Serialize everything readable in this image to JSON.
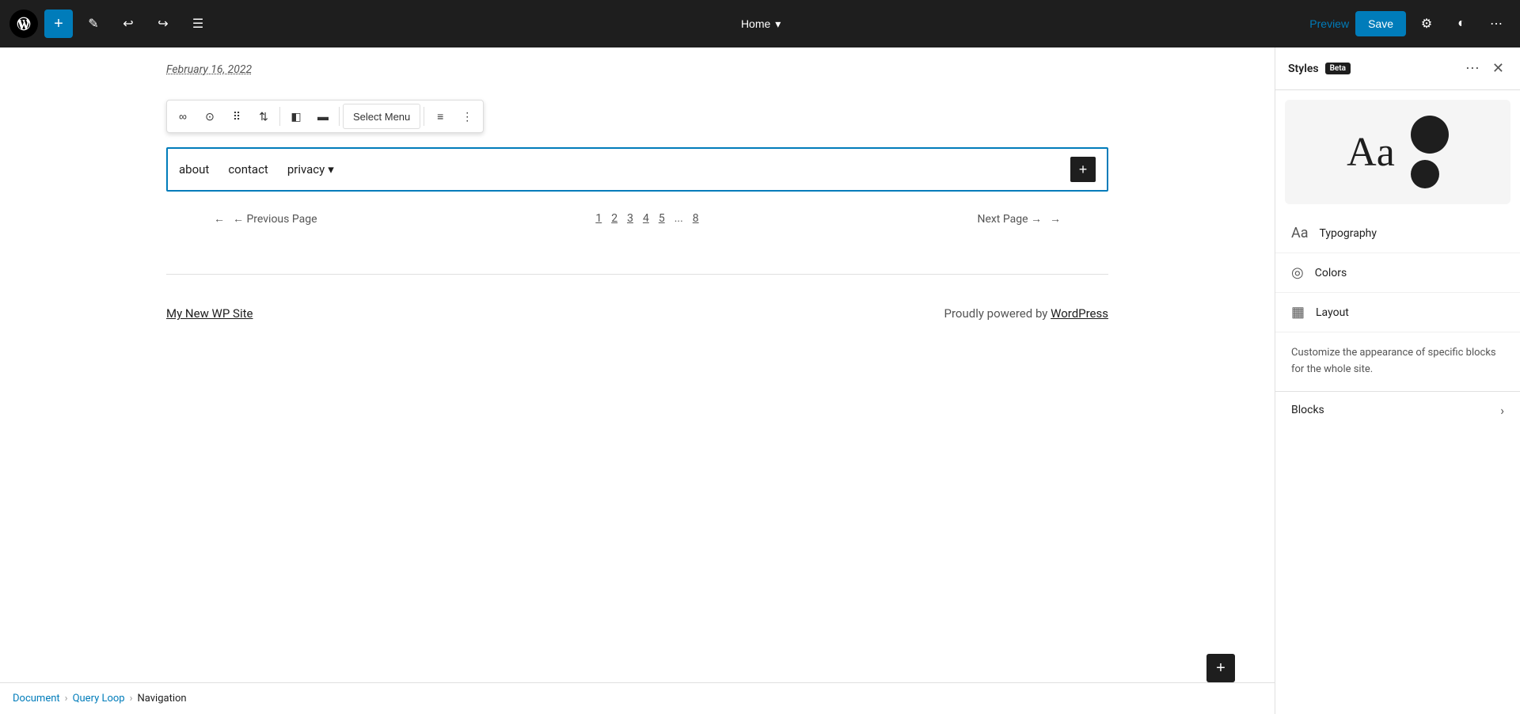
{
  "toolbar": {
    "add_label": "+",
    "preview_label": "Preview",
    "save_label": "Save",
    "page_title": "Home",
    "undo_icon": "↩",
    "redo_icon": "↪",
    "list_view_icon": "☰",
    "edit_icon": "✎",
    "settings_icon": "⚙",
    "contrast_icon": "◐",
    "more_icon": "⋯"
  },
  "canvas": {
    "date": "February 16, 2022",
    "nav": {
      "items": [
        {
          "label": "about",
          "has_dropdown": false
        },
        {
          "label": "contact",
          "has_dropdown": false
        },
        {
          "label": "privacy",
          "has_dropdown": true
        }
      ]
    },
    "pagination": {
      "prev_label": "← Previous Page",
      "next_label": "Next Page →",
      "pages": [
        "1",
        "2",
        "3",
        "4",
        "5",
        "...",
        "8"
      ]
    },
    "footer": {
      "site_link": "My New WP Site",
      "credit_text": "Proudly powered by ",
      "credit_link": "WordPress"
    }
  },
  "right_panel": {
    "header": {
      "title": "Styles",
      "beta_label": "Beta",
      "more_icon": "⋯",
      "close_icon": "✕"
    },
    "preview": {
      "text": "Aa"
    },
    "items": [
      {
        "id": "typography",
        "icon": "Aa",
        "label": "Typography"
      },
      {
        "id": "colors",
        "icon": "◎",
        "label": "Colors"
      },
      {
        "id": "layout",
        "icon": "▦",
        "label": "Layout"
      }
    ],
    "customize_text": "Customize the appearance of specific blocks for the whole site.",
    "blocks_label": "Blocks",
    "chevron": "›"
  },
  "breadcrumb": {
    "items": [
      {
        "label": "Document",
        "active": true
      },
      {
        "label": "Query Loop",
        "active": true
      },
      {
        "label": "Navigation",
        "active": false
      }
    ]
  },
  "block_toolbar": {
    "buttons": [
      {
        "id": "link",
        "icon": "∞"
      },
      {
        "id": "info",
        "icon": "⓪"
      },
      {
        "id": "drag",
        "icon": "⠿"
      },
      {
        "id": "move",
        "icon": "⌃"
      },
      {
        "id": "align-left",
        "icon": "◧"
      },
      {
        "id": "align-center",
        "icon": "▬"
      },
      {
        "id": "select-menu",
        "icon": "",
        "label": "Select Menu",
        "is_select": true
      },
      {
        "id": "justify",
        "icon": "≡"
      },
      {
        "id": "more",
        "icon": "⋮"
      }
    ]
  }
}
